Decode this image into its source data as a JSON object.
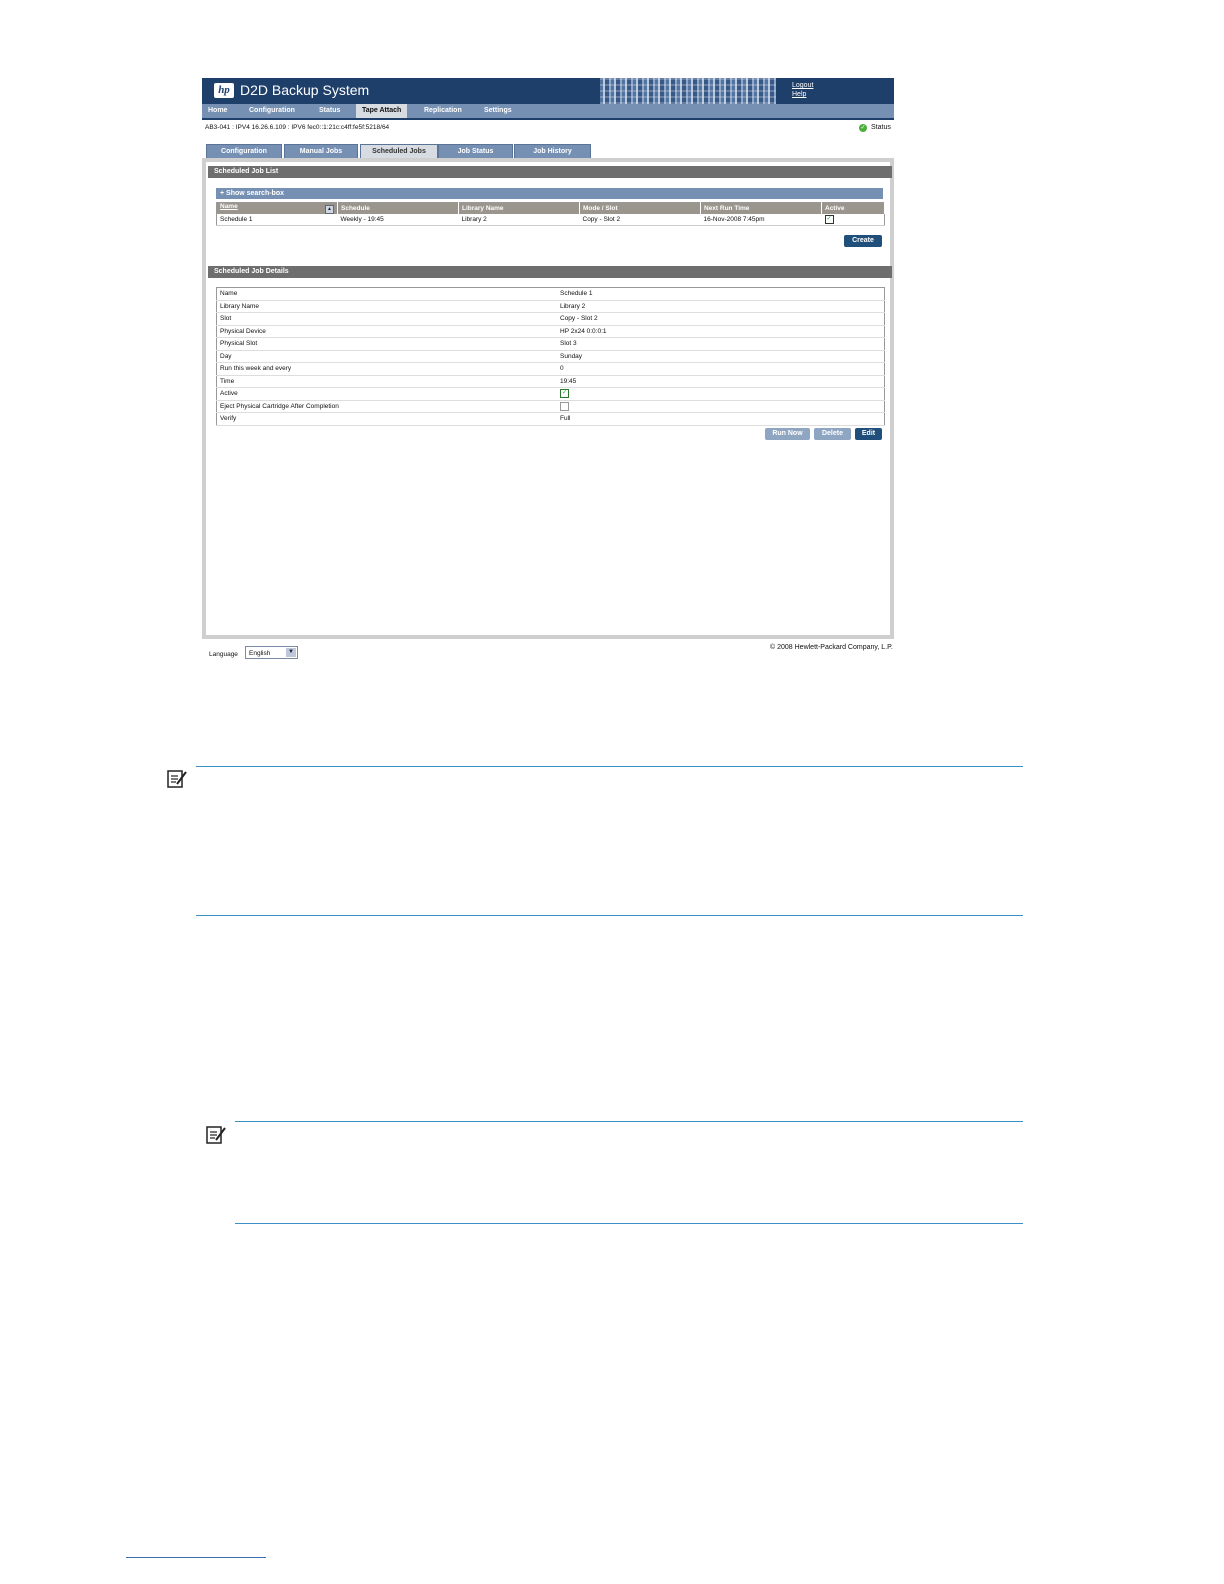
{
  "header": {
    "title": "D2D Backup System",
    "logout_label": "Logout",
    "help_label": "Help"
  },
  "menu": [
    "Home",
    "Configuration",
    "Status",
    "Tape Attach",
    "Replication",
    "Settings"
  ],
  "menu_active": "Tape Attach",
  "ip_info": "AB3-041 : IPV4 16.26.6.109 : IPV6 fec0::1:21c:c4ff:fe5f:5218/64",
  "status_label": "Status",
  "tabs": [
    "Configuration",
    "Manual Jobs",
    "Scheduled Jobs",
    "Job Status",
    "Job History"
  ],
  "tabs_active": "Scheduled Jobs",
  "job_list": {
    "section_title": "Scheduled Job List",
    "search_toggle": "+ Show search-box",
    "columns": [
      "Name",
      "Schedule",
      "Library Name",
      "Mode / Slot",
      "Next Run Time",
      "Active"
    ],
    "rows": [
      {
        "name": "Schedule 1",
        "schedule": "Weekly - 19:45",
        "library": "Library 2",
        "mode_slot": "Copy  -  Slot 2",
        "next_run": "16-Nov-2008 7:45pm",
        "active": true
      }
    ],
    "create_label": "Create"
  },
  "job_details": {
    "section_title": "Scheduled Job Details",
    "fields": [
      {
        "label": "Name",
        "value": "Schedule 1"
      },
      {
        "label": "Library Name",
        "value": "Library 2"
      },
      {
        "label": "Slot",
        "value": "Copy  -  Slot 2"
      },
      {
        "label": "Physical Device",
        "value": "HP 2x24 0:0:0:1"
      },
      {
        "label": "Physical Slot",
        "value": "Slot 3"
      },
      {
        "label": "Day",
        "value": "Sunday"
      },
      {
        "label": "Run this week and every",
        "value": "0"
      },
      {
        "label": "Time",
        "value": "19:45"
      },
      {
        "label": "Active",
        "value": "",
        "checkbox": true,
        "checked": true
      },
      {
        "label": "Eject Physical Cartridge After Completion",
        "value": "",
        "checkbox": true,
        "checked": false
      },
      {
        "label": "Verify",
        "value": "Full"
      }
    ],
    "buttons": {
      "run_now": "Run Now",
      "delete": "Delete",
      "edit": "Edit"
    }
  },
  "footer": {
    "language_label": "Language",
    "language_value": "English",
    "copyright": "© 2008 Hewlett-Packard Company, L.P."
  },
  "colors": {
    "header": "#1f3f6b",
    "menu": "#7690b4",
    "section": "#6e6e6e",
    "link_rule": "#3a8fc4"
  },
  "icons": [
    "hp-logo-icon",
    "status-ok-icon",
    "sort-icon",
    "checkbox-checked-icon",
    "dropdown-arrow-icon",
    "note-icon"
  ]
}
